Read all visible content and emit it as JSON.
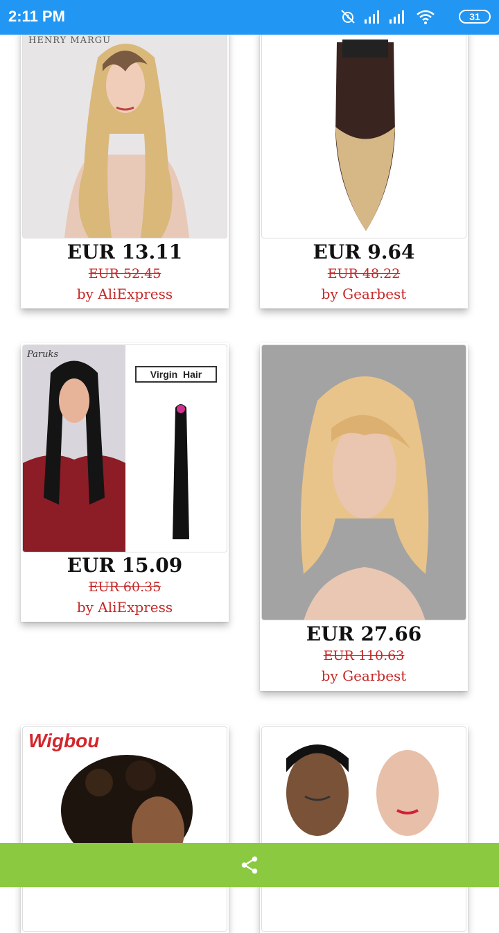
{
  "status_bar": {
    "time": "2:11 PM",
    "battery": "31",
    "icons": [
      "alarm-off-icon",
      "signal-icon",
      "signal-icon",
      "wifi-icon",
      "battery-icon"
    ]
  },
  "products": [
    {
      "price": "EUR 13.11",
      "old_price": "EUR 52.45",
      "seller": "by AliExpress",
      "brand_text": "HENRY MARGU"
    },
    {
      "price": "EUR 9.64",
      "old_price": "EUR 48.22",
      "seller": "by Gearbest"
    },
    {
      "price": "EUR 15.09",
      "old_price": "EUR 60.35",
      "seller": "by AliExpress",
      "brand_text": "Paruks",
      "label_text": "Virgin  Hair"
    },
    {
      "price": "EUR 27.66",
      "old_price": "EUR 110.63",
      "seller": "by Gearbest"
    },
    {
      "brand_text": "Wigbou"
    },
    {}
  ],
  "bottom_bar": {
    "icon": "share-icon",
    "color": "#8BC940"
  },
  "colors": {
    "status_bar": "#2196F3",
    "accent_red": "#c62828"
  }
}
